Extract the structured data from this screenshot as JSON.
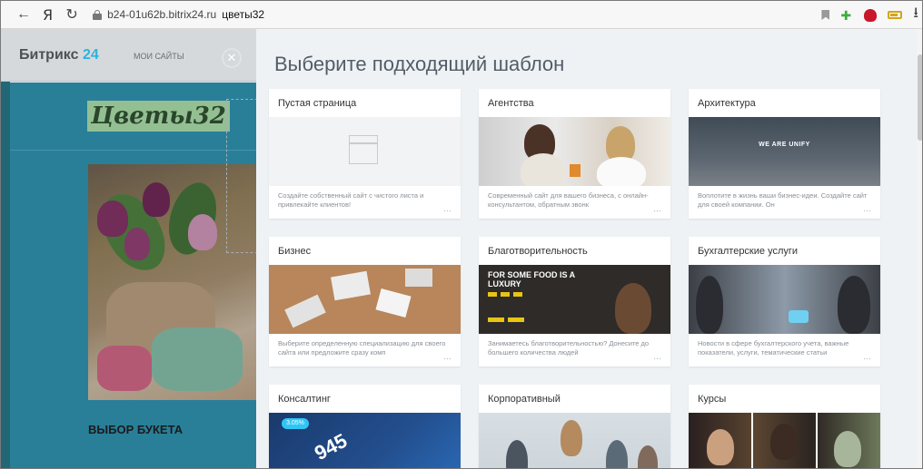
{
  "browser": {
    "back_glyph": "←",
    "yandex_glyph": "Я",
    "reload_glyph": "↻",
    "url_domain": "b24-01u62b.bitrix24.ru",
    "url_path": "цветы32",
    "download_glyph": "⭳"
  },
  "site": {
    "brand_text": "Битрикс",
    "brand_num": "24",
    "mysites": "МОИ САЙТЫ",
    "logo_text": "Цветы32",
    "choose_bouquet": "ВЫБОР БУКЕТА"
  },
  "slider": {
    "close_glyph": "✕",
    "title": "Выберите подходящий шаблон",
    "cards": [
      {
        "title": "Пустая страница",
        "desc": "Создайте собственный сайт с чистого листа и привлекайте клиентов!"
      },
      {
        "title": "Агентства",
        "desc": "Современный сайт для вашего бизнеса, с онлайн-консультантом, обратным звонк"
      },
      {
        "title": "Архитектура",
        "desc": "Воплотите в жизнь ваши бизнес-идеи. Создайте сайт для своей компании. Он",
        "img_text": "WE ARE UNIFY"
      },
      {
        "title": "Бизнес",
        "desc": "Выберите определенную специализацию для своего сайта или предложите сразу комп"
      },
      {
        "title": "Благотворительность",
        "desc": "Занимаетесь благотворительностью? Донесите до большего количества людей",
        "img_text": "FOR SOME FOOD IS A LUXURY"
      },
      {
        "title": "Бухгалтерские услуги",
        "desc": "Новости в сфере бухгалтерского учета, важные показатели, услуги, тематические статьи"
      },
      {
        "title": "Консалтинг",
        "desc": "",
        "img_big": "945",
        "img_pill": "3.05%"
      },
      {
        "title": "Корпоративный",
        "desc": ""
      },
      {
        "title": "Курсы",
        "desc": ""
      }
    ],
    "more_glyph": "…"
  }
}
